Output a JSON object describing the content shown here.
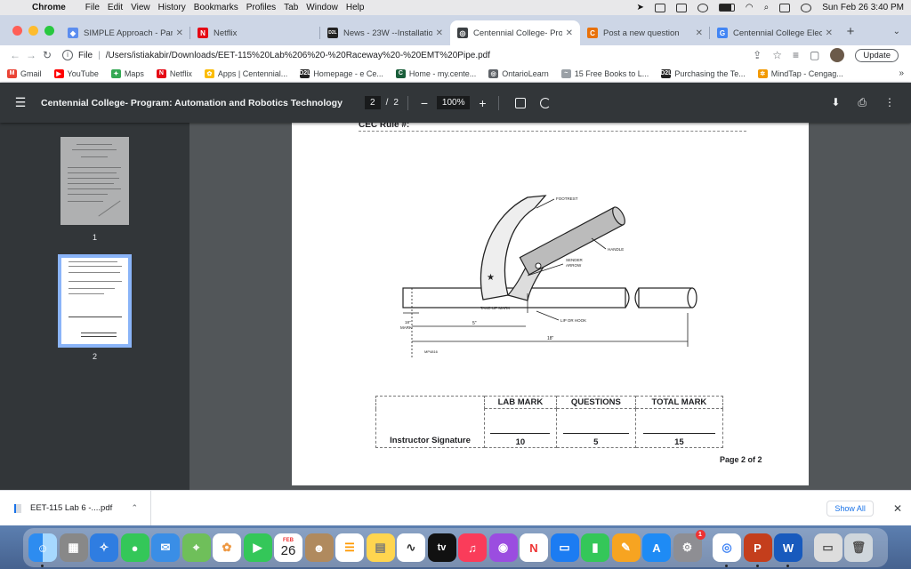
{
  "menubar": {
    "app": "Chrome",
    "items": [
      "File",
      "Edit",
      "View",
      "History",
      "Bookmarks",
      "Profiles",
      "Tab",
      "Window",
      "Help"
    ],
    "datetime": "Sun Feb 26  3:40 PM"
  },
  "tabs": [
    {
      "label": "SIMPLE Approach - Part",
      "color": "#5b8def",
      "glyph": "◆"
    },
    {
      "label": "Netflix",
      "color": "#e50914",
      "glyph": "N"
    },
    {
      "label": "News - 23W --Installatio",
      "color": "#222222",
      "glyph": "D2L"
    },
    {
      "label": "Centennial College- Prog",
      "color": "#3c4043",
      "glyph": "◎",
      "active": true
    },
    {
      "label": "Post a new question",
      "color": "#e8710a",
      "glyph": "C"
    },
    {
      "label": "Centennial College Electr",
      "color": "#4285f4",
      "glyph": "G"
    }
  ],
  "address": {
    "scheme": "File",
    "url": "/Users/istiakabir/Downloads/EET-115%20Lab%206%20-%20Raceway%20-%20EMT%20Pipe.pdf",
    "update_label": "Update"
  },
  "bookmarks": [
    {
      "label": "Gmail",
      "color": "#ea4335",
      "glyph": "M"
    },
    {
      "label": "YouTube",
      "color": "#ff0000",
      "glyph": "▶"
    },
    {
      "label": "Maps",
      "color": "#34a853",
      "glyph": "✦"
    },
    {
      "label": "Netflix",
      "color": "#e50914",
      "glyph": "N"
    },
    {
      "label": "Apps | Centennial...",
      "color": "#fbbc04",
      "glyph": "✿"
    },
    {
      "label": "Homepage - e Ce...",
      "color": "#222222",
      "glyph": "D2L"
    },
    {
      "label": "Home - my.cente...",
      "color": "#1a5e3a",
      "glyph": "C"
    },
    {
      "label": "OntarioLearn",
      "color": "#5f6368",
      "glyph": "◎"
    },
    {
      "label": "15 Free Books to L...",
      "color": "#9aa0a6",
      "glyph": "~"
    },
    {
      "label": "Purchasing the Te...",
      "color": "#222222",
      "glyph": "D2L"
    },
    {
      "label": "MindTap - Cengag...",
      "color": "#f29900",
      "glyph": "✲"
    }
  ],
  "pdf": {
    "title": "Centennial College- Program: Automation and Robotics Technology",
    "page_current": "2",
    "page_total": "2",
    "zoom": "100%",
    "thumbnail_labels": [
      "1",
      "2"
    ]
  },
  "document": {
    "cec_rule": "CEC Rule #:",
    "diagram_labels": {
      "footrest": "FOOTREST",
      "handle": "HANDLE",
      "sender_arrow_1": "SENDER",
      "sender_arrow_2": "ARROW",
      "take_up_mark": "TAKE-UP MARK",
      "lip_or_hook": "LIP OR HOOK",
      "dim_5": "5\"",
      "dim_18": "18\"",
      "mark_18_1": "18\"",
      "mark_18_2": "MARK",
      "figure_id": "MP4816"
    },
    "marks_table": {
      "headers": [
        "LAB MARK",
        "QUESTIONS",
        "TOTAL MARK"
      ],
      "row_label": "Instructor Signature",
      "values": [
        "10",
        "5",
        "15"
      ]
    },
    "page_footer": "Page 2 of 2"
  },
  "download": {
    "filename": "EET-115 Lab 6 -....pdf",
    "show_all": "Show All"
  },
  "dock": {
    "calendar_month": "FEB",
    "calendar_day": "26",
    "tv_label": "tv",
    "badge_count": "1"
  }
}
